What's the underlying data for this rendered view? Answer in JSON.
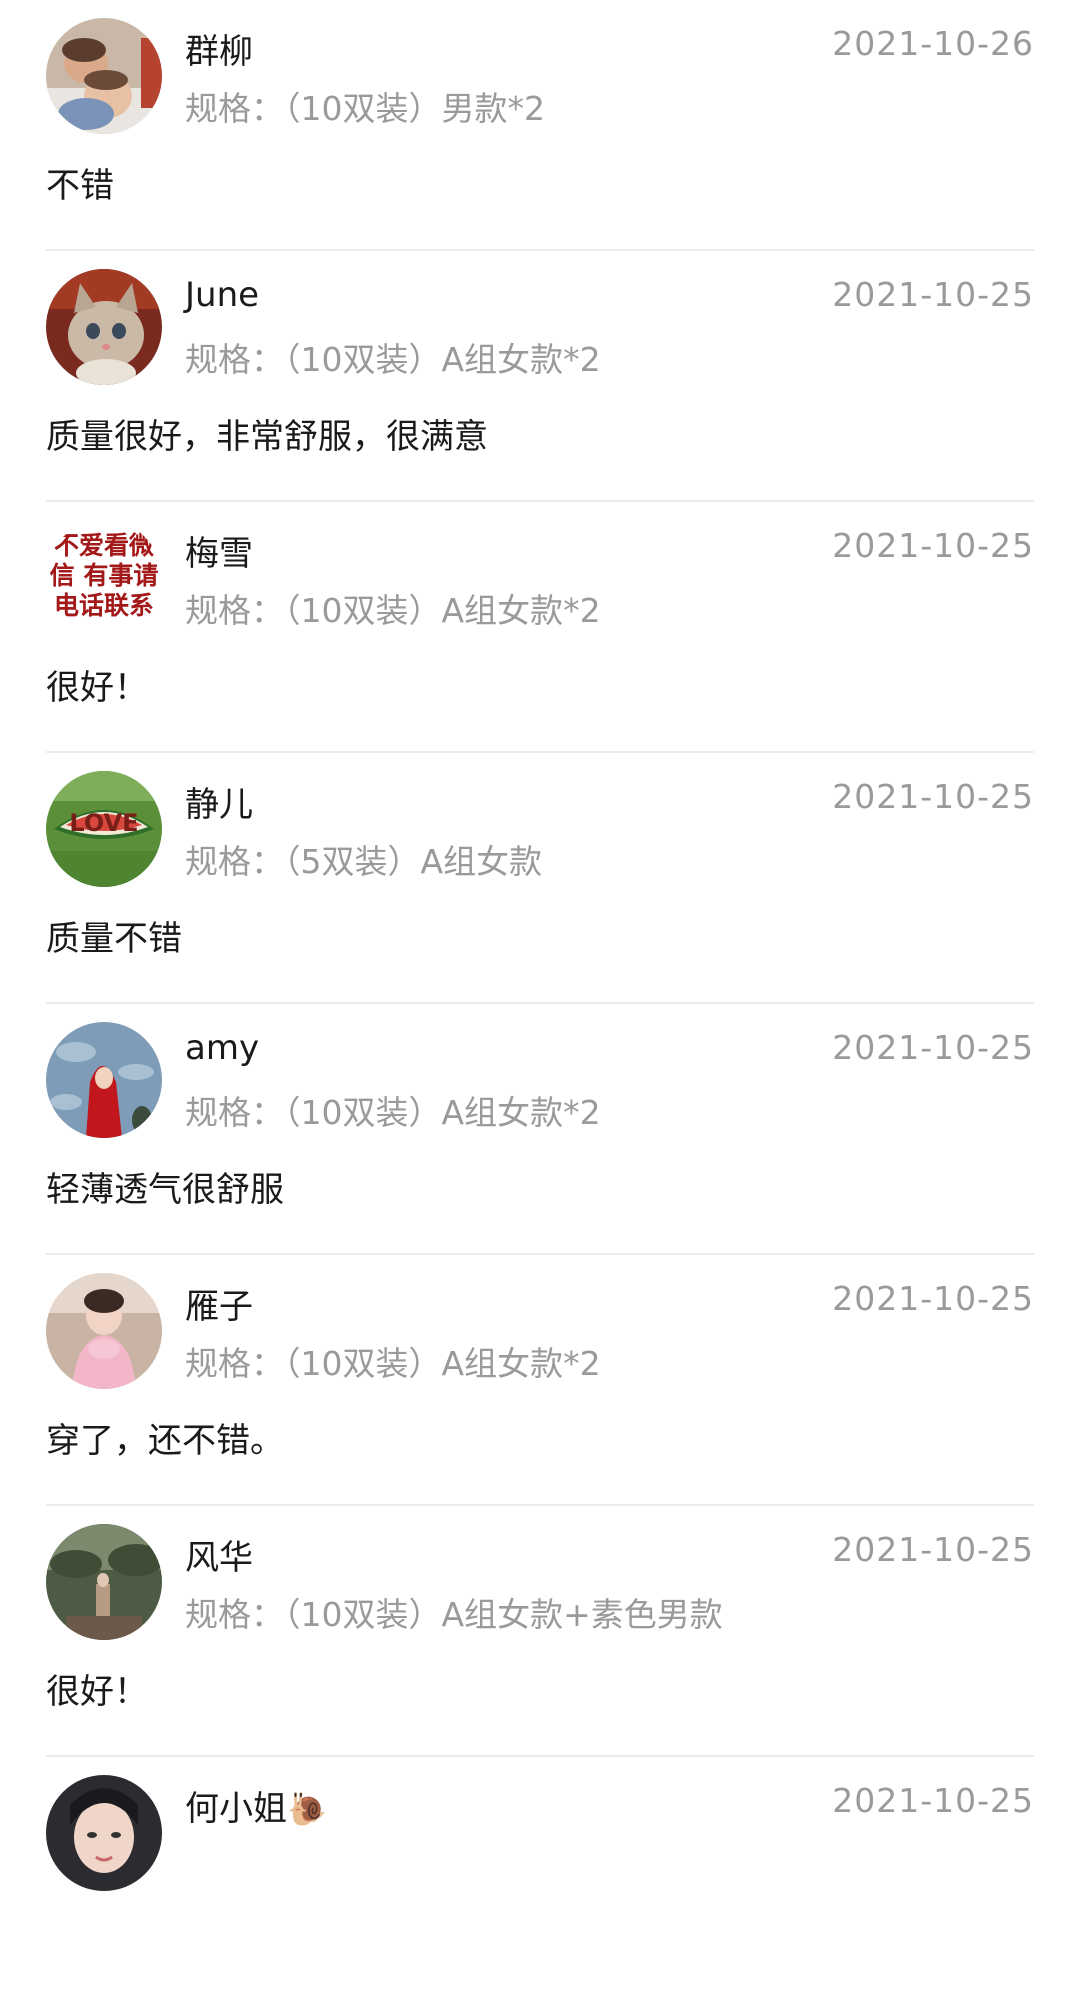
{
  "reviews": [
    {
      "name": "群柳",
      "spec": "规格：（10双装）男款*2",
      "date": "2021-10-26",
      "comment": "不错",
      "avatar": "babies-photo"
    },
    {
      "name": "June",
      "spec": "规格：（10双装）A组女款*2",
      "date": "2021-10-25",
      "comment": "质量很好，非常舒服，很满意",
      "avatar": "kitten-photo"
    },
    {
      "name": "梅雪",
      "spec": "规格：（10双装）A组女款*2",
      "date": "2021-10-25",
      "comment": "很好！",
      "avatar": "text-avatar",
      "avatar_text": [
        "不爱看微",
        "信 有事请",
        "电话联系"
      ]
    },
    {
      "name": "静儿",
      "spec": "规格：（5双装）A组女款",
      "date": "2021-10-25",
      "comment": "质量不错",
      "avatar": "watermelon-love-photo",
      "avatar_text": [
        "LOVE"
      ]
    },
    {
      "name": "amy",
      "spec": "规格：（10双装）A组女款*2",
      "date": "2021-10-25",
      "comment": "轻薄透气很舒服",
      "avatar": "red-hood-woman-photo"
    },
    {
      "name": "雁子",
      "spec": "规格：（10双装）A组女款*2",
      "date": "2021-10-25",
      "comment": "穿了，还不错。",
      "avatar": "girl-pink-photo"
    },
    {
      "name": "风华",
      "spec": "规格：（10双装）A组女款+素色男款",
      "date": "2021-10-25",
      "comment": "很好！",
      "avatar": "landscape-photo"
    },
    {
      "name": "何小姐",
      "name_emoji": "🐌",
      "spec": "",
      "date": "2021-10-25",
      "comment": "",
      "avatar": "woman-portrait-photo"
    }
  ]
}
